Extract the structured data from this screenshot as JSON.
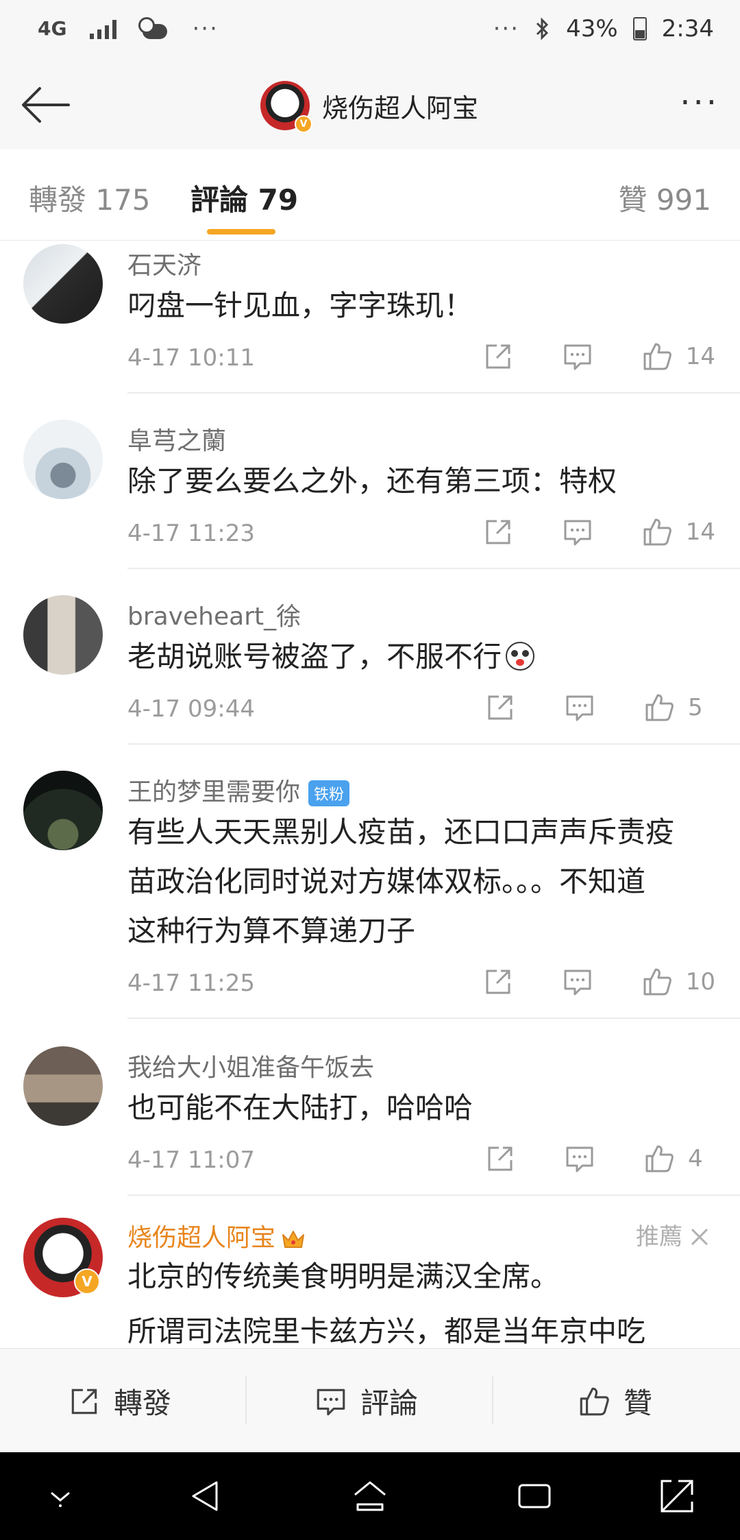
{
  "status_bar": {
    "network": "4G",
    "battery": "43%",
    "time": "2:34",
    "overflow": "···"
  },
  "header": {
    "title": "烧伤超人阿宝",
    "more": "···"
  },
  "tabs": [
    {
      "label": "轉發 175"
    },
    {
      "label": "評論 79"
    },
    {
      "label": "贊 991"
    }
  ],
  "comments": [
    {
      "user": "石天济",
      "text": [
        "叼盘一针见血，字字珠玑！"
      ],
      "time": "4-17 10:11",
      "likes": "14"
    },
    {
      "user": "阜芎之蘭",
      "text": [
        "除了要么要么之外，还有第三项：特权"
      ],
      "time": "4-17 11:23",
      "likes": "14"
    },
    {
      "user": "braveheart_徐",
      "text": [
        "老胡说账号被盗了，不服不行"
      ],
      "time": "4-17 09:44",
      "likes": "5"
    },
    {
      "user": "王的梦里需要你",
      "badge": "铁粉",
      "text": [
        "有些人天天黑别人疫苗，还口口声声斥责疫",
        "苗政治化同时说对方媒体双标。。。不知道",
        "这种行为算不算递刀子"
      ],
      "time": "4-17 11:25",
      "likes": "10"
    },
    {
      "user": "我给大小姐准备午饭去",
      "text": [
        "也可能不在大陆打，哈哈哈"
      ],
      "time": "4-17 11:07",
      "likes": "4"
    },
    {
      "user": "烧伤超人阿宝",
      "text": [
        "北京的传统美食明明是满汉全席。"
      ],
      "recommend": "推薦",
      "partial": "所谓司法院里卡兹方兴，都是当年京中吃"
    }
  ],
  "bottom_bar": {
    "repost": "轉發",
    "comment": "評論",
    "like": "贊"
  },
  "colors": {
    "accent": "#f5a623",
    "vip_name": "#e8851c",
    "fan_badge": "#4aa1ee"
  },
  "icons": [
    "back-arrow-icon",
    "more-icon",
    "share-icon",
    "comment-icon",
    "like-icon",
    "crown-icon",
    "close-icon",
    "nav-down-icon",
    "nav-back-icon",
    "nav-home-icon",
    "nav-recent-icon",
    "nav-expand-icon"
  ]
}
